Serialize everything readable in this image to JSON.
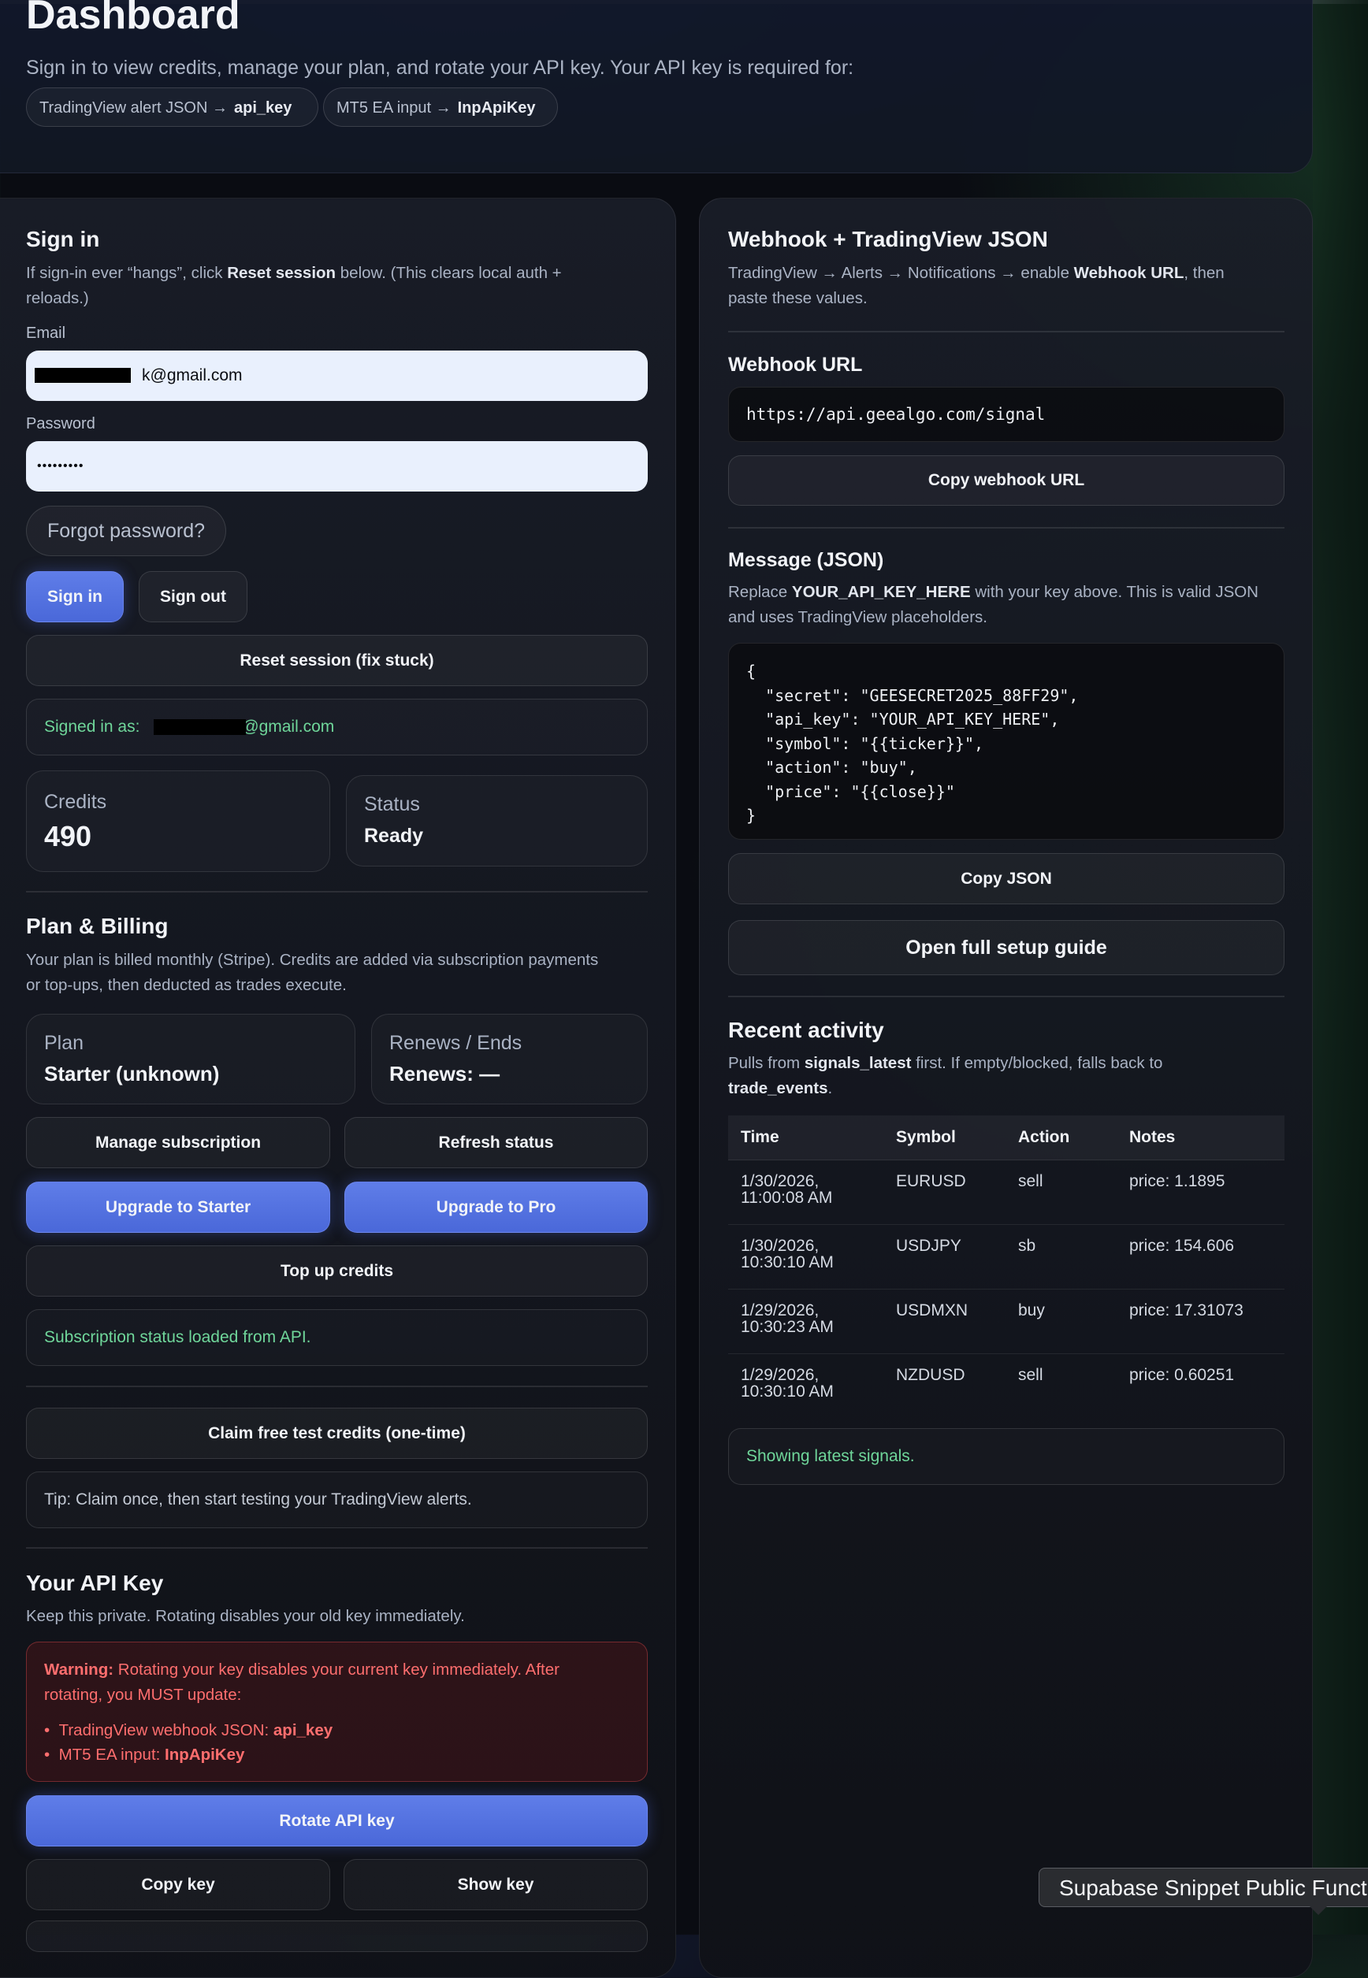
{
  "header": {
    "title": "Dashboard",
    "subtitle": "Sign in to view credits, manage your plan, and rotate your API key. Your API key is required for:",
    "pills": [
      {
        "prefix": "TradingView alert JSON →",
        "key": "api_key"
      },
      {
        "prefix": "MT5 EA input →",
        "key": "InpApiKey"
      }
    ]
  },
  "signin": {
    "heading": "Sign in",
    "hint_prefix": "If sign-in ever “hangs”, click ",
    "hint_bold": "Reset session",
    "hint_line1_suffix": " below. (This clears local auth +",
    "hint_line2": "reloads.)",
    "email_label": "Email",
    "email_value": "k@gmail.com",
    "password_label": "Password",
    "password_value": "•••••••••",
    "forgot_label": "Forgot password?",
    "signin_label": "Sign in",
    "signout_label": "Sign out",
    "reset_label": "Reset session (fix stuck)",
    "signed_in_prefix": "Signed in as: ",
    "signed_in_email": "@gmail.com"
  },
  "stats": {
    "credits_label": "Credits",
    "credits_value": "490",
    "status_label": "Status",
    "status_value": "Ready"
  },
  "billing": {
    "heading": "Plan & Billing",
    "desc_line1": "Your plan is billed monthly (Stripe). Credits are added via subscription payments",
    "desc_line2": "or top-ups, then deducted as trades execute.",
    "plan_label": "Plan",
    "plan_value": "Starter (unknown)",
    "renews_label": "Renews / Ends",
    "renews_value": "Renews: —",
    "manage_label": "Manage subscription",
    "refresh_label": "Refresh status",
    "upgrade_starter_label": "Upgrade to Starter",
    "upgrade_pro_label": "Upgrade to Pro",
    "topup_label": "Top up credits",
    "status_text": "Subscription status loaded from API."
  },
  "free_credits": {
    "claim_label": "Claim free test credits (one-time)",
    "tip": "Tip: Claim once, then start testing your TradingView alerts."
  },
  "api_key": {
    "heading": "Your API Key",
    "desc": "Keep this private. Rotating disables your old key immediately.",
    "warning_bold": "Warning:",
    "warning_line1": " Rotating your key disables your current key immediately. After",
    "warning_line2": "rotating, you MUST update:",
    "bullets": [
      {
        "prefix": "TradingView webhook JSON: ",
        "key": "api_key"
      },
      {
        "prefix": "MT5 EA input: ",
        "key": "InpApiKey"
      }
    ],
    "rotate_label": "Rotate API key",
    "copy_label": "Copy key",
    "show_label": "Show key"
  },
  "webhook": {
    "heading": "Webhook + TradingView JSON",
    "desc_prefix": "TradingView → Alerts → Notifications → enable ",
    "desc_bold": "Webhook URL",
    "desc_suffix": ", then",
    "desc_line2": "paste these values.",
    "url_heading": "Webhook URL",
    "url_value": "https://api.geealgo.com/signal",
    "copy_url_label": "Copy webhook URL",
    "message_heading": "Message (JSON)",
    "message_desc_prefix": "Replace ",
    "message_desc_bold": "YOUR_API_KEY_HERE",
    "message_desc_suffix": " with your key above. This is valid JSON",
    "message_desc_line2": "and uses TradingView placeholders.",
    "json_lines": [
      "{",
      "  \"secret\": \"GEESECRET2025_88FF29\",",
      "  \"api_key\": \"YOUR_API_KEY_HERE\",",
      "  \"symbol\": \"{{ticker}}\",",
      "  \"action\": \"buy\",",
      "  \"price\": \"{{close}}\"",
      "}"
    ],
    "copy_json_label": "Copy JSON",
    "guide_label": "Open full setup guide"
  },
  "activity": {
    "heading": "Recent activity",
    "desc_prefix": "Pulls from ",
    "desc_bold1": "signals_latest",
    "desc_mid": " first. If empty/blocked, falls back to",
    "desc_bold2": "trade_events",
    "desc_end": ".",
    "columns": [
      "Time",
      "Symbol",
      "Action",
      "Notes"
    ],
    "rows": [
      {
        "time1": "1/30/2026,",
        "time2": "11:00:08 AM",
        "symbol": "EURUSD",
        "action": "sell",
        "notes": "price: 1.1895"
      },
      {
        "time1": "1/30/2026,",
        "time2": "10:30:10 AM",
        "symbol": "USDJPY",
        "action": "sb",
        "notes": "price: 154.606"
      },
      {
        "time1": "1/29/2026,",
        "time2": "10:30:23 AM",
        "symbol": "USDMXN",
        "action": "buy",
        "notes": "price: 17.31073"
      },
      {
        "time1": "1/29/2026,",
        "time2": "10:30:10 AM",
        "symbol": "NZDUSD",
        "action": "sell",
        "notes": "price: 0.60251"
      }
    ],
    "status_text": "Showing latest signals."
  },
  "tooltip": {
    "text": "Supabase Snippet Public Functions"
  }
}
